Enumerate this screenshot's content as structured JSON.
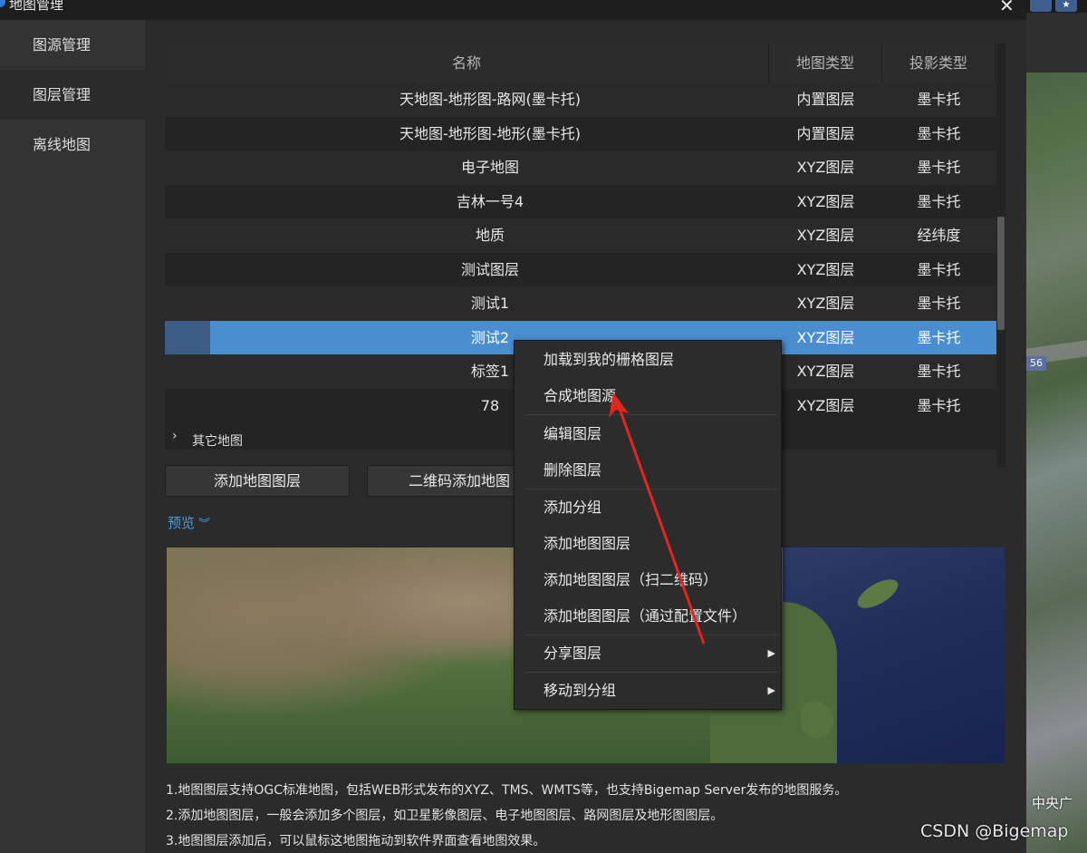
{
  "window": {
    "title": "地图管理",
    "close_glyph": "✕"
  },
  "sidebar": {
    "items": [
      {
        "label": "图源管理"
      },
      {
        "label": "图层管理"
      },
      {
        "label": "离线地图"
      }
    ]
  },
  "table": {
    "columns": [
      "名称",
      "地图类型",
      "投影类型"
    ],
    "rows": [
      {
        "name": "天地图-地形图-路网(墨卡托)",
        "type": "内置图层",
        "projection": "墨卡托"
      },
      {
        "name": "天地图-地形图-地形(墨卡托)",
        "type": "内置图层",
        "projection": "墨卡托"
      },
      {
        "name": "电子地图",
        "type": "XYZ图层",
        "projection": "墨卡托"
      },
      {
        "name": "吉林一号4",
        "type": "XYZ图层",
        "projection": "墨卡托"
      },
      {
        "name": "地质",
        "type": "XYZ图层",
        "projection": "经纬度"
      },
      {
        "name": "测试图层",
        "type": "XYZ图层",
        "projection": "墨卡托"
      },
      {
        "name": "测试1",
        "type": "XYZ图层",
        "projection": "墨卡托"
      },
      {
        "name": "测试2",
        "type": "XYZ图层",
        "projection": "墨卡托",
        "selected": true
      },
      {
        "name": "标签1",
        "type": "XYZ图层",
        "projection": "墨卡托"
      },
      {
        "name": "78",
        "type": "XYZ图层",
        "projection": "墨卡托"
      }
    ],
    "group_label": "其它地图"
  },
  "buttons": {
    "add_layer": "添加地图图层",
    "qr_add": "二维码添加地图"
  },
  "preview": {
    "label": "预览"
  },
  "notes": [
    "1.地图图层支持OGC标准地图，包括WEB形式发布的XYZ、TMS、WMTS等，也支持Bigemap Server发布的地图服务。",
    "2.添加地图图层，一般会添加多个图层，如卫星影像图层、电子地图图层、路网图层及地形图图层。",
    "3.地图图层添加后，可以鼠标这地图拖动到软件界面查看地图效果。"
  ],
  "context_menu": {
    "items": [
      {
        "label": "加载到我的栅格图层"
      },
      {
        "label": "合成地图源"
      },
      {
        "label": "编辑图层"
      },
      {
        "label": "删除图层"
      },
      {
        "label": "添加分组"
      },
      {
        "label": "添加地图图层"
      },
      {
        "label": "添加地图图层（扫二维码）"
      },
      {
        "label": "添加地图图层（通过配置文件）"
      },
      {
        "label": "分享图层"
      },
      {
        "label": "移动到分组"
      }
    ]
  },
  "background_map": {
    "road_badge": "56",
    "place_label": "中央广"
  },
  "watermark": "CSDN @Bigemap",
  "colors": {
    "selection": "#4a8ed0",
    "accent_link": "#4a9be0",
    "annotation_arrow": "#e0261e"
  }
}
